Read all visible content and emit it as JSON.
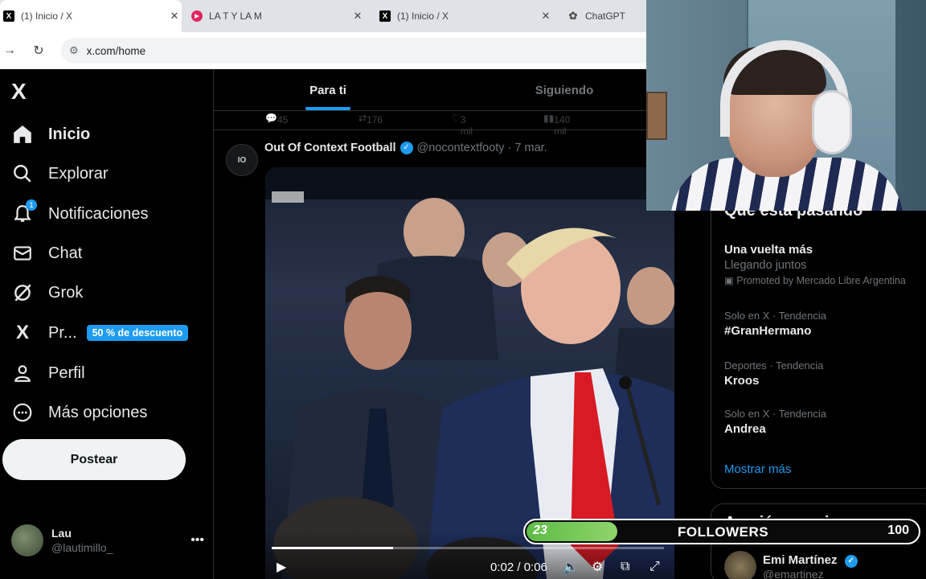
{
  "browser": {
    "tabs": [
      {
        "title": "(1) Inicio / X",
        "icon": "x-icon"
      },
      {
        "title": "LA T Y LA M",
        "icon": "youtube-icon"
      },
      {
        "title": "(1) Inicio / X",
        "icon": "x-icon"
      },
      {
        "title": "ChatGPT",
        "icon": "chatgpt-icon"
      }
    ],
    "url": "x.com/home"
  },
  "sidebar": {
    "logo": "X",
    "items": [
      {
        "label": "Inicio",
        "icon": "home-icon"
      },
      {
        "label": "Explorar",
        "icon": "search-icon"
      },
      {
        "label": "Notificaciones",
        "icon": "bell-icon",
        "badge": "1"
      },
      {
        "label": "Chat",
        "icon": "mail-icon"
      },
      {
        "label": "Grok",
        "icon": "grok-icon"
      },
      {
        "label": "Pr...",
        "icon": "x-premium-icon",
        "promo": "50 % de descuento"
      },
      {
        "label": "Perfil",
        "icon": "person-icon"
      },
      {
        "label": "Más opciones",
        "icon": "more-circle-icon"
      }
    ],
    "post_button": "Postear",
    "user": {
      "name": "Lau",
      "handle": "@lautimillo_"
    }
  },
  "timeline": {
    "tabs": [
      "Para ti",
      "Siguiendo"
    ],
    "metrics": {
      "replies": "45",
      "reposts": "176",
      "likes": "3 mil",
      "views": "140 mil"
    },
    "tweet": {
      "author": "Out Of Context Football",
      "handle": "@nocontextfooty",
      "date": "· 7 mar.",
      "avatar_text": "IO",
      "video": {
        "time": "0:02 / 0:06",
        "progress": 0.31,
        "channel_logo": "BBC"
      }
    }
  },
  "right": {
    "trends_title": "Qué está pasando",
    "trends": [
      {
        "context": "",
        "name": "Una vuelta más",
        "subtitle": "Llegando juntos",
        "promo": "Promoted by Mercado Libre Argentina"
      },
      {
        "context": "Solo en X · Tendencia",
        "name": "#GranHermano"
      },
      {
        "context": "Deportes · Tendencia",
        "name": "Kroos"
      },
      {
        "context": "Solo en X · Tendencia",
        "name": "Andrea"
      }
    ],
    "show_more": "Mostrar más",
    "follow_title": "A quién seguir",
    "follow_user": {
      "name": "Emi Martínez",
      "handle": "@emartinez"
    }
  },
  "goal": {
    "current": "23",
    "label": "FOLLOWERS",
    "target": "100",
    "fraction": 0.23
  }
}
